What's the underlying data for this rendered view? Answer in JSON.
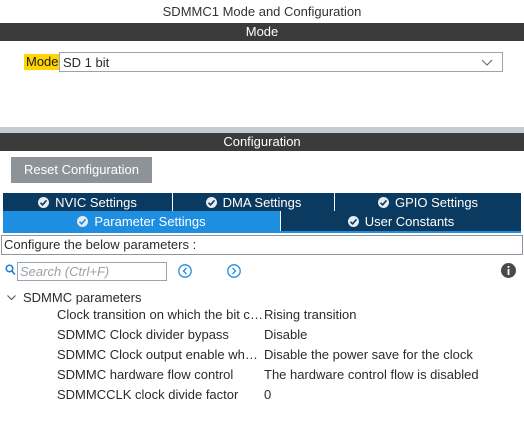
{
  "window": {
    "title": "SDMMC1 Mode and Configuration"
  },
  "mode_section": {
    "header": "Mode",
    "label": "Mode",
    "selected": "SD 1 bit"
  },
  "config_section": {
    "header": "Configuration",
    "reset_label": "Reset Configuration",
    "tabs": [
      {
        "label": "NVIC Settings",
        "active": false
      },
      {
        "label": "DMA Settings",
        "active": false
      },
      {
        "label": "GPIO Settings",
        "active": false
      },
      {
        "label": "Parameter Settings",
        "active": true
      },
      {
        "label": "User Constants",
        "active": false
      }
    ],
    "instructions": "Configure the below parameters :",
    "search": {
      "placeholder": "Search (Ctrl+F)"
    },
    "group": {
      "label": "SDMMC parameters",
      "params": [
        {
          "name": "Clock transition on which the bit capture is made",
          "display_name": "Clock transition on which the bit captu",
          "value": "Rising transition"
        },
        {
          "name": "SDMMC Clock divider bypass",
          "display_name": "SDMMC Clock divider bypass",
          "value": "Disable"
        },
        {
          "name": "SDMMC Clock output enable when the bus is idle",
          "display_name": "SDMMC Clock output enable when t...",
          "value": "Disable the power save for the clock"
        },
        {
          "name": "SDMMC hardware flow control",
          "display_name": "SDMMC hardware flow control",
          "value": "The hardware control flow is disabled"
        },
        {
          "name": "SDMMCCLK clock divide factor",
          "display_name": "SDMMCCLK clock divide factor",
          "value": "0"
        }
      ]
    }
  },
  "colors": {
    "header_bg": "#3b3b3b",
    "tab_bg": "#0b3a60",
    "tab_active": "#1e8ee0",
    "mode_highlight": "#ffd400",
    "reset_btn": "#8d9399"
  }
}
